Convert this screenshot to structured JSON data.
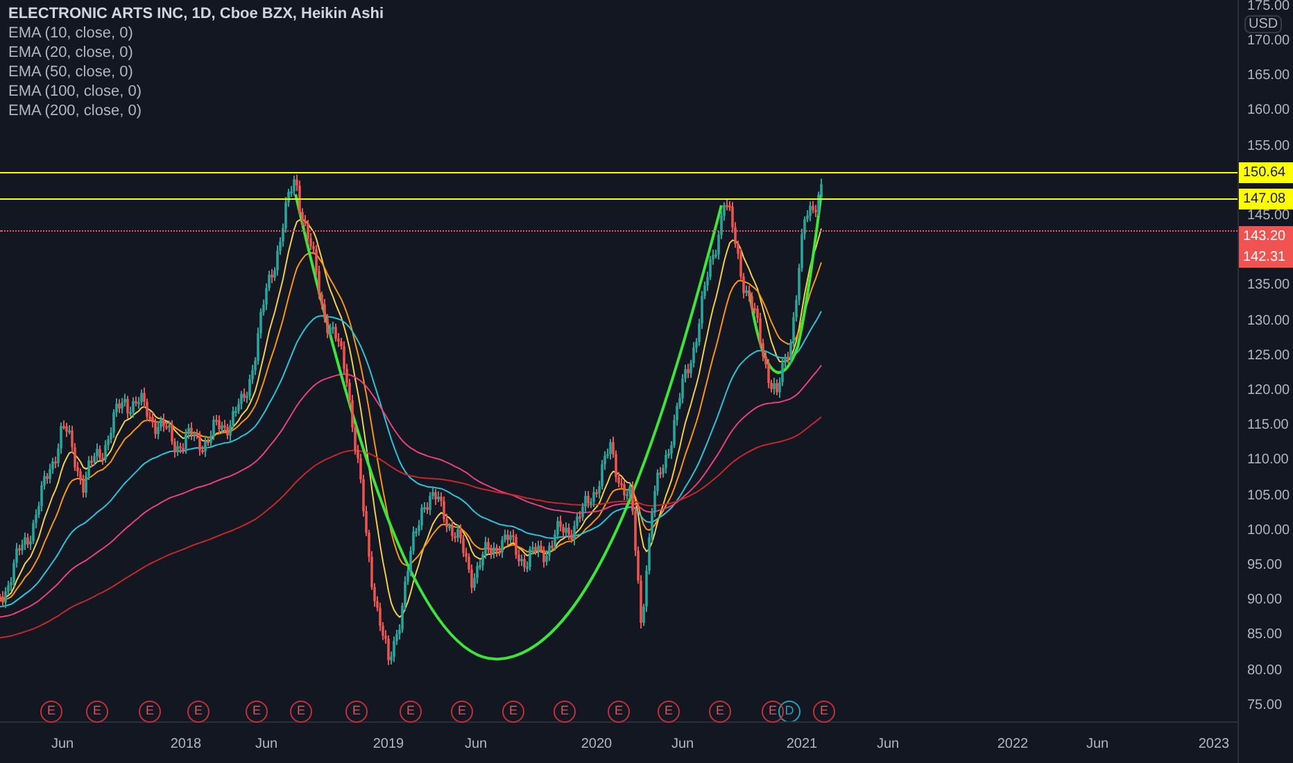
{
  "legend": {
    "title": "ELECTRONIC ARTS INC, 1D, Cboe BZX, Heikin Ashi",
    "studies": [
      "EMA (10, close, 0)",
      "EMA (20, close, 0)",
      "EMA (50, close, 0)",
      "EMA (100, close, 0)",
      "EMA (200, close, 0)"
    ]
  },
  "currency": "USD",
  "y_axis": {
    "ticks": [
      "175.00",
      "170.00",
      "165.00",
      "160.00",
      "155.00",
      "145.00",
      "135.00",
      "130.00",
      "125.00",
      "120.00",
      "115.00",
      "110.00",
      "105.00",
      "100.00",
      "95.00",
      "90.00",
      "85.00",
      "80.00",
      "75.00"
    ]
  },
  "price_labels": [
    {
      "label": "150.64",
      "color": "#ffff00",
      "kind": "line"
    },
    {
      "label": "147.08",
      "color": "#ffff00",
      "kind": "line"
    },
    {
      "label": "143.20",
      "color": "#f05350",
      "kind": "dotted"
    },
    {
      "label": "142.31",
      "color": "#f05350",
      "kind": "none"
    }
  ],
  "events": [
    {
      "label": "E",
      "kind": "earnings"
    },
    {
      "label": "E",
      "kind": "earnings"
    },
    {
      "label": "E",
      "kind": "earnings"
    },
    {
      "label": "E",
      "kind": "earnings"
    },
    {
      "label": "E",
      "kind": "earnings"
    },
    {
      "label": "E",
      "kind": "earnings"
    },
    {
      "label": "E",
      "kind": "earnings"
    },
    {
      "label": "E",
      "kind": "earnings"
    },
    {
      "label": "E",
      "kind": "earnings"
    },
    {
      "label": "E",
      "kind": "earnings"
    },
    {
      "label": "E",
      "kind": "earnings"
    },
    {
      "label": "E",
      "kind": "earnings"
    },
    {
      "label": "E",
      "kind": "earnings"
    },
    {
      "label": "E",
      "kind": "earnings"
    },
    {
      "label": "E",
      "kind": "earnings"
    },
    {
      "label": "D",
      "kind": "dividend"
    },
    {
      "label": "E",
      "kind": "earnings"
    }
  ],
  "x_axis": {
    "labels": [
      "Jun",
      "2018",
      "Jun",
      "2019",
      "Jun",
      "2020",
      "Jun",
      "2021",
      "Jun",
      "2022",
      "Jun",
      "2023"
    ]
  }
}
